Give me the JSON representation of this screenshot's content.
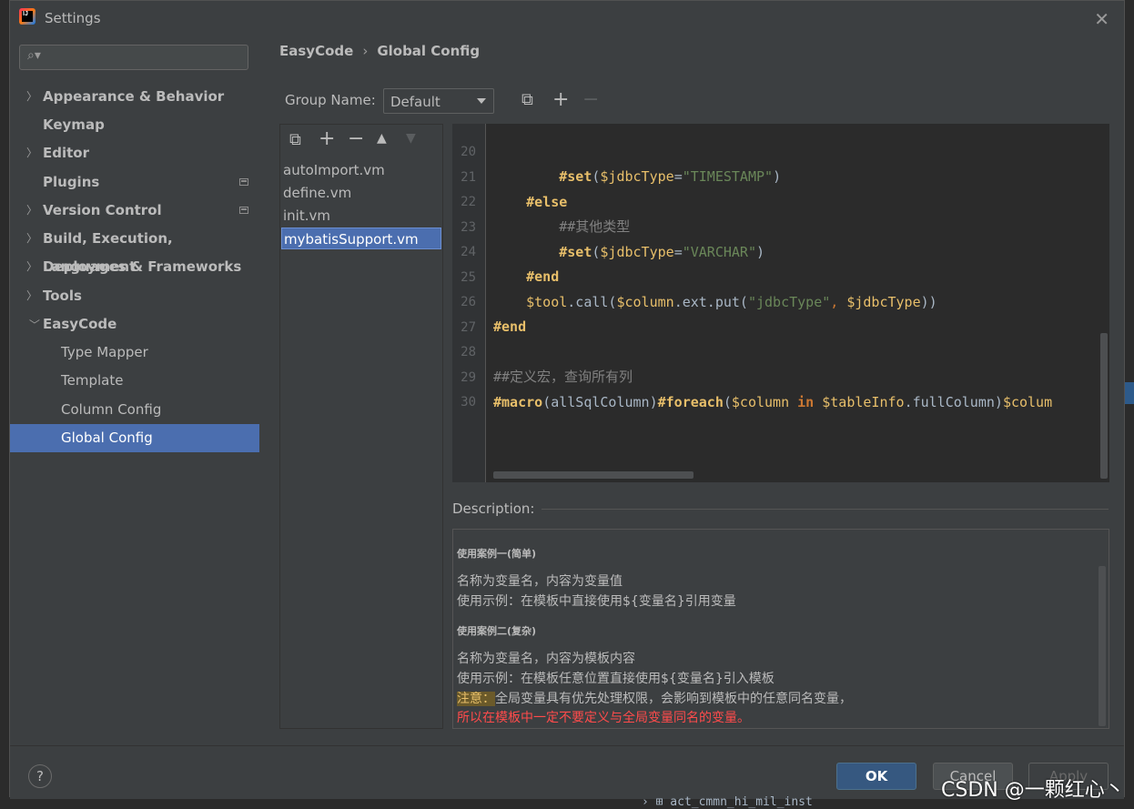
{
  "window": {
    "title": "Settings",
    "close_icon": "close-icon"
  },
  "sidebar": {
    "search_placeholder": "",
    "items": [
      {
        "label": "Appearance & Behavior",
        "expandable": true,
        "badge": false
      },
      {
        "label": "Keymap",
        "expandable": false,
        "badge": false
      },
      {
        "label": "Editor",
        "expandable": true,
        "badge": false
      },
      {
        "label": "Plugins",
        "expandable": false,
        "badge": true
      },
      {
        "label": "Version Control",
        "expandable": true,
        "badge": true
      },
      {
        "label": "Build, Execution, Deployment",
        "expandable": true,
        "badge": false
      },
      {
        "label": "Languages & Frameworks",
        "expandable": true,
        "badge": false
      },
      {
        "label": "Tools",
        "expandable": true,
        "badge": false
      },
      {
        "label": "EasyCode",
        "expandable": true,
        "expanded": true,
        "badge": false
      },
      {
        "label": "Type Mapper",
        "child": true
      },
      {
        "label": "Template",
        "child": true
      },
      {
        "label": "Column Config",
        "child": true
      },
      {
        "label": "Global Config",
        "child": true,
        "selected": true
      }
    ]
  },
  "breadcrumb": {
    "parent": "EasyCode",
    "separator": "›",
    "current": "Global Config"
  },
  "group": {
    "label": "Group Name:",
    "value": "Default"
  },
  "files": [
    "autoImport.vm",
    "define.vm",
    "init.vm",
    "mybatisSupport.vm"
  ],
  "selected_file": "mybatisSupport.vm",
  "editor": {
    "line_numbers": [
      "20",
      "21",
      "22",
      "23",
      "24",
      "25",
      "26",
      "27",
      "28",
      "29",
      "30"
    ]
  },
  "description": {
    "label": "Description:",
    "case1_title": "使用案例一(简单)",
    "case1_line1": "名称为变量名，内容为变量值",
    "case1_line2": "使用示例：在模板中直接使用${变量名}引用变量",
    "case2_title": "使用案例二(复杂)",
    "case2_line1": "名称为变量名，内容为模板内容",
    "case2_line2": "使用示例：在模板任意位置直接使用${变量名}引入模板",
    "note_label": "注意：",
    "note_text": "全局变量具有优先处理权限，会影响到模板中的任意同名变量，",
    "warning": "所以在模板中一定不要定义与全局变量同名的变量。"
  },
  "footer": {
    "help": "?",
    "ok": "OK",
    "cancel": "Cancel",
    "apply": "Apply"
  },
  "background": {
    "bottom_text": "› ⊞ act_cmmn_hi_mil_inst"
  },
  "watermark": "CSDN @一颗红心丶",
  "colors": {
    "selection": "#4b6eaf",
    "keyword": "#cc7832",
    "string": "#6a8759",
    "warning": "#ff4b4b"
  }
}
